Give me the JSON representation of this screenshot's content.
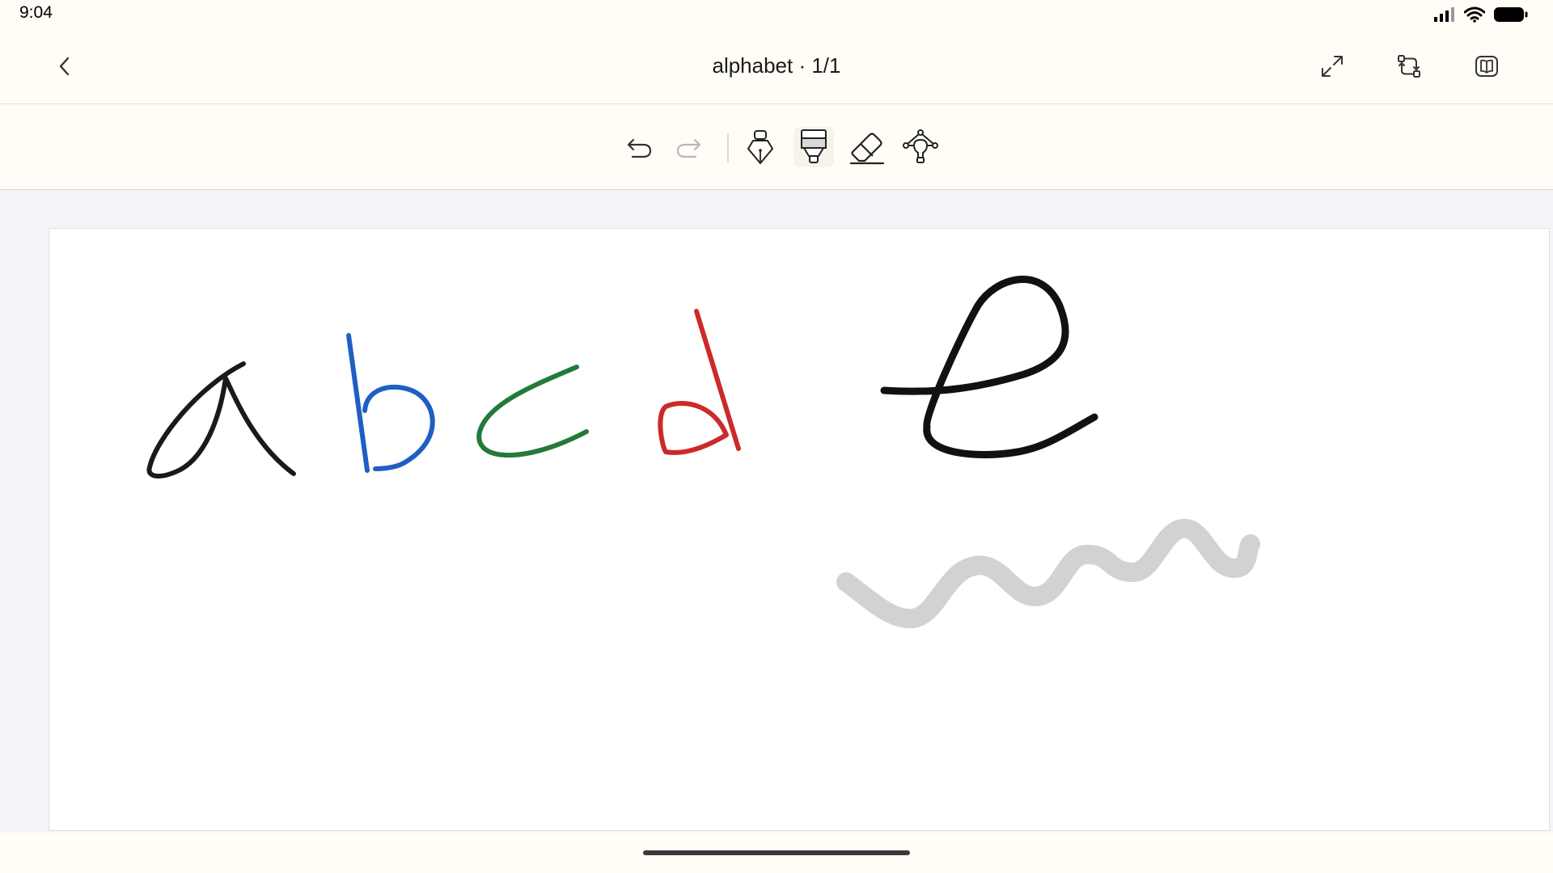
{
  "status_bar": {
    "time": "9:04",
    "icons": [
      "signal-icon",
      "wifi-icon",
      "battery-icon"
    ]
  },
  "header": {
    "title": "alphabet · 1/1",
    "back_icon": "chevron-left-icon",
    "actions": [
      "expand-icon",
      "swap-pages-icon",
      "book-icon"
    ]
  },
  "toolbar": {
    "tools": [
      "undo-icon",
      "redo-icon",
      "fountain-pen-icon",
      "highlighter-icon",
      "eraser-icon",
      "lasso-select-icon"
    ],
    "active_tool": "highlighter"
  },
  "canvas": {
    "strokes": [
      {
        "name": "letter-a",
        "color": "#1a1a1a"
      },
      {
        "name": "letter-b",
        "color": "#1f5fc4"
      },
      {
        "name": "letter-c",
        "color": "#237a3a"
      },
      {
        "name": "letter-d",
        "color": "#cc2a2a"
      },
      {
        "name": "letter-e",
        "color": "#111111"
      },
      {
        "name": "highlighter-squiggle",
        "color": "#d2d2d2"
      }
    ]
  },
  "colors": {
    "background": "#fffdf5",
    "workspace": "#f4f4f8",
    "page": "#ffffff"
  }
}
